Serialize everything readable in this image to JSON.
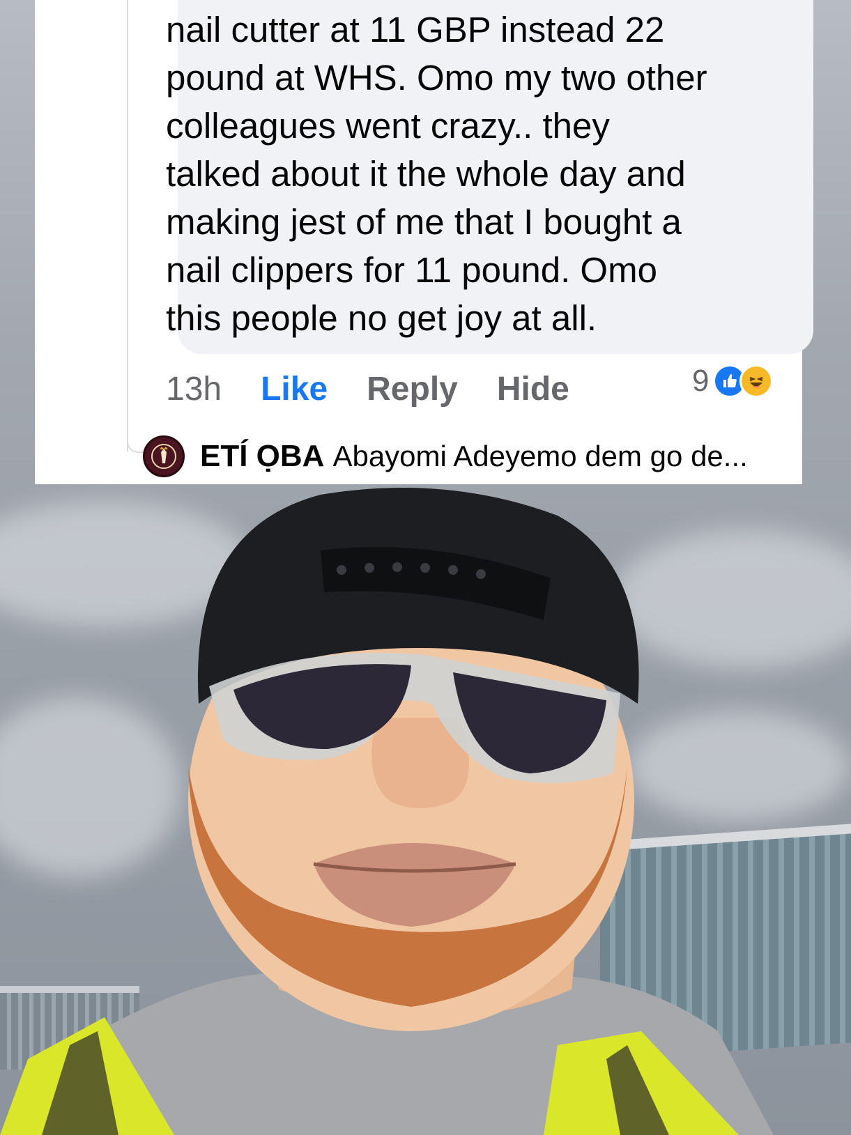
{
  "comment": {
    "lines": [
      "nail cutter at 11 GBP instead 22",
      "pound at WHS. Omo my two other",
      "colleagues went crazy.. they",
      "talked about it the whole day  and",
      "making jest of me that I bought a",
      "nail clippers for 11 pound. Omo",
      "this people no get joy at all."
    ],
    "time": "13h",
    "like_label": "Like",
    "reply_label": "Reply",
    "hide_label": "Hide",
    "reaction_count": "9",
    "reaction_icons": [
      "like-reaction-icon",
      "haha-reaction-icon"
    ]
  },
  "reply_preview": {
    "author": "ETÍ ỌBA",
    "text": "Abayomi Adeyemo dem go de..."
  },
  "colors": {
    "like_blue": "#1877f2",
    "muted_gray": "#65676b",
    "bubble_bg": "#f0f2f5"
  }
}
